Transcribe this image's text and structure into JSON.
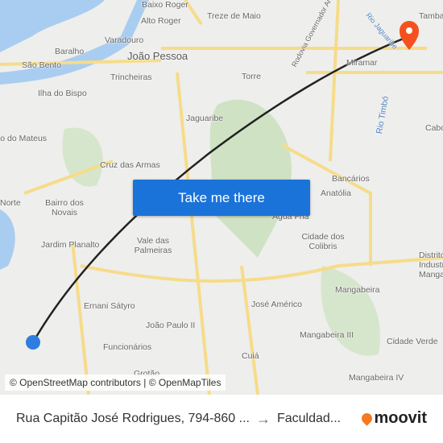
{
  "map": {
    "labels": [
      "Baixo Roger",
      "Alto Roger",
      "Treze de Maio",
      "Baralho",
      "Varadouro",
      "João Pessoa",
      "São Bento",
      "Trincheiras",
      "Torre",
      "Ilha do Bispo",
      "Jaguaribe",
      "Rodovia Governador Antônio Mariz",
      "Rio Jaguaribe",
      "Miramar",
      "Tambaú",
      "Rio Timbó",
      "Cabo",
      "Alto do Mateus",
      "Cruz das Armas",
      "Bancários",
      "Anatólia",
      "Bairro dos Novais",
      "Água Fria",
      "Cidade dos Colibris",
      "Jardim Planalto",
      "Vale das Palmeiras",
      "Distrito Industrial de Mangabeira",
      "Ernani Sátyro",
      "José Américo",
      "Mangabeira",
      "João Paulo II",
      "Mangabeira III",
      "Funcionários",
      "Cuiá",
      "Cidade Verde",
      "Mangabeira IV",
      "Grotão",
      "Norte"
    ],
    "route_color": "#222222",
    "origin_color": "#2f7de1",
    "destination_color": "#f4511e"
  },
  "cta": {
    "label": "Take me there",
    "color": "#1a73d9"
  },
  "attribution": "© OpenStreetMap contributors | © OpenMapTiles",
  "footer": {
    "origin": "Rua Capitão José Rodrigues, 794-860 ...",
    "arrow": "→",
    "destination": "Faculdad...",
    "brand": "moovit",
    "brand_color": "#f47a20"
  }
}
